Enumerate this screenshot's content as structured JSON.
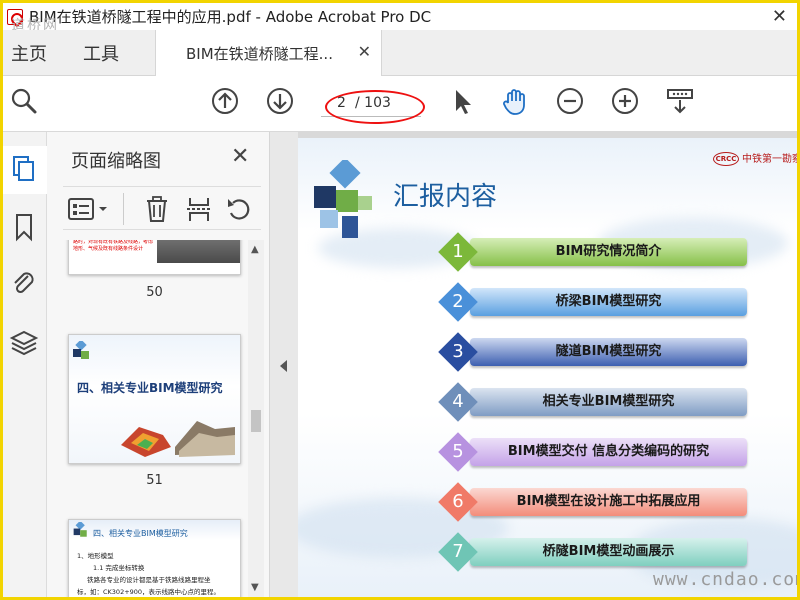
{
  "window": {
    "title": "BIM在铁道桥隧工程中的应用.pdf - Adobe Acrobat Pro DC",
    "watermark_top": "道桥网",
    "close_glyph": "✕"
  },
  "menu": {
    "home": "主页",
    "tools": "工具"
  },
  "tab": {
    "label": "BIM在铁道桥隧工程...",
    "close_glyph": "✕"
  },
  "toolbar": {
    "page_current": "2",
    "page_total": "/ 103",
    "icons": [
      "search-icon",
      "page-up-icon",
      "page-down-icon",
      "select-pointer-icon",
      "hand-icon",
      "zoom-out-icon",
      "zoom-in-icon",
      "read-mode-icon"
    ]
  },
  "rail": {
    "icons": [
      "page-thumbnails-icon",
      "bookmarks-icon",
      "attachments-icon",
      "layers-icon"
    ]
  },
  "thumbnails": {
    "title": "页面缩略图",
    "close_glyph": "✕",
    "pages": [
      {
        "number": "50",
        "text": "路时，对现有既有铁路及线路，考虑地形、气候及既有线路条件设计",
        "red_text": true
      },
      {
        "number": "51",
        "title": "四、相关专业BIM模型研究"
      },
      {
        "number": "52",
        "heading": "四、相关专业BIM模型研究",
        "lines": [
          "1、地形模型",
          "1.1 完成坐标转换",
          "铁路各专业的设计都是基于铁路线路里程坐",
          "标，如：CK302+900，表示线路中心点的里程。"
        ]
      }
    ]
  },
  "slide": {
    "title": "汇报内容",
    "company": "中铁第一勘察",
    "company_logo_text": "CRCC",
    "items": [
      {
        "num": "1",
        "label": "BIM研究情况简介",
        "color": "#7cb83a",
        "bar_from": "#d6eeb8",
        "bar_to": "#86c048"
      },
      {
        "num": "2",
        "label": "桥梁BIM模型研究",
        "color": "#4a90d9",
        "bar_from": "#d2e6fa",
        "bar_to": "#5a9fe0"
      },
      {
        "num": "3",
        "label": "隧道BIM模型研究",
        "color": "#2a4ea0",
        "bar_from": "#cdd8f0",
        "bar_to": "#3d5fb0"
      },
      {
        "num": "4",
        "label": "相关专业BIM模型研究",
        "color": "#6f8fba",
        "bar_from": "#dbe4f0",
        "bar_to": "#7f9cc4"
      },
      {
        "num": "5",
        "label": "BIM模型交付 信息分类编码的研究",
        "color": "#b792e0",
        "bar_from": "#ece0f8",
        "bar_to": "#c4a2e8"
      },
      {
        "num": "6",
        "label": "BIM模型在设计施工中拓展应用",
        "color": "#f07a68",
        "bar_from": "#fbd8d2",
        "bar_to": "#f38c7a"
      },
      {
        "num": "7",
        "label": "桥隧BIM模型动画展示",
        "color": "#6fc5b5",
        "bar_from": "#d6f1ec",
        "bar_to": "#7fcfbf"
      }
    ]
  },
  "watermark_bottom": "www.cndao.com",
  "colors": {
    "frame": "#f2d400",
    "ellipse": "#e11111",
    "accent": "#1d5fa0"
  }
}
